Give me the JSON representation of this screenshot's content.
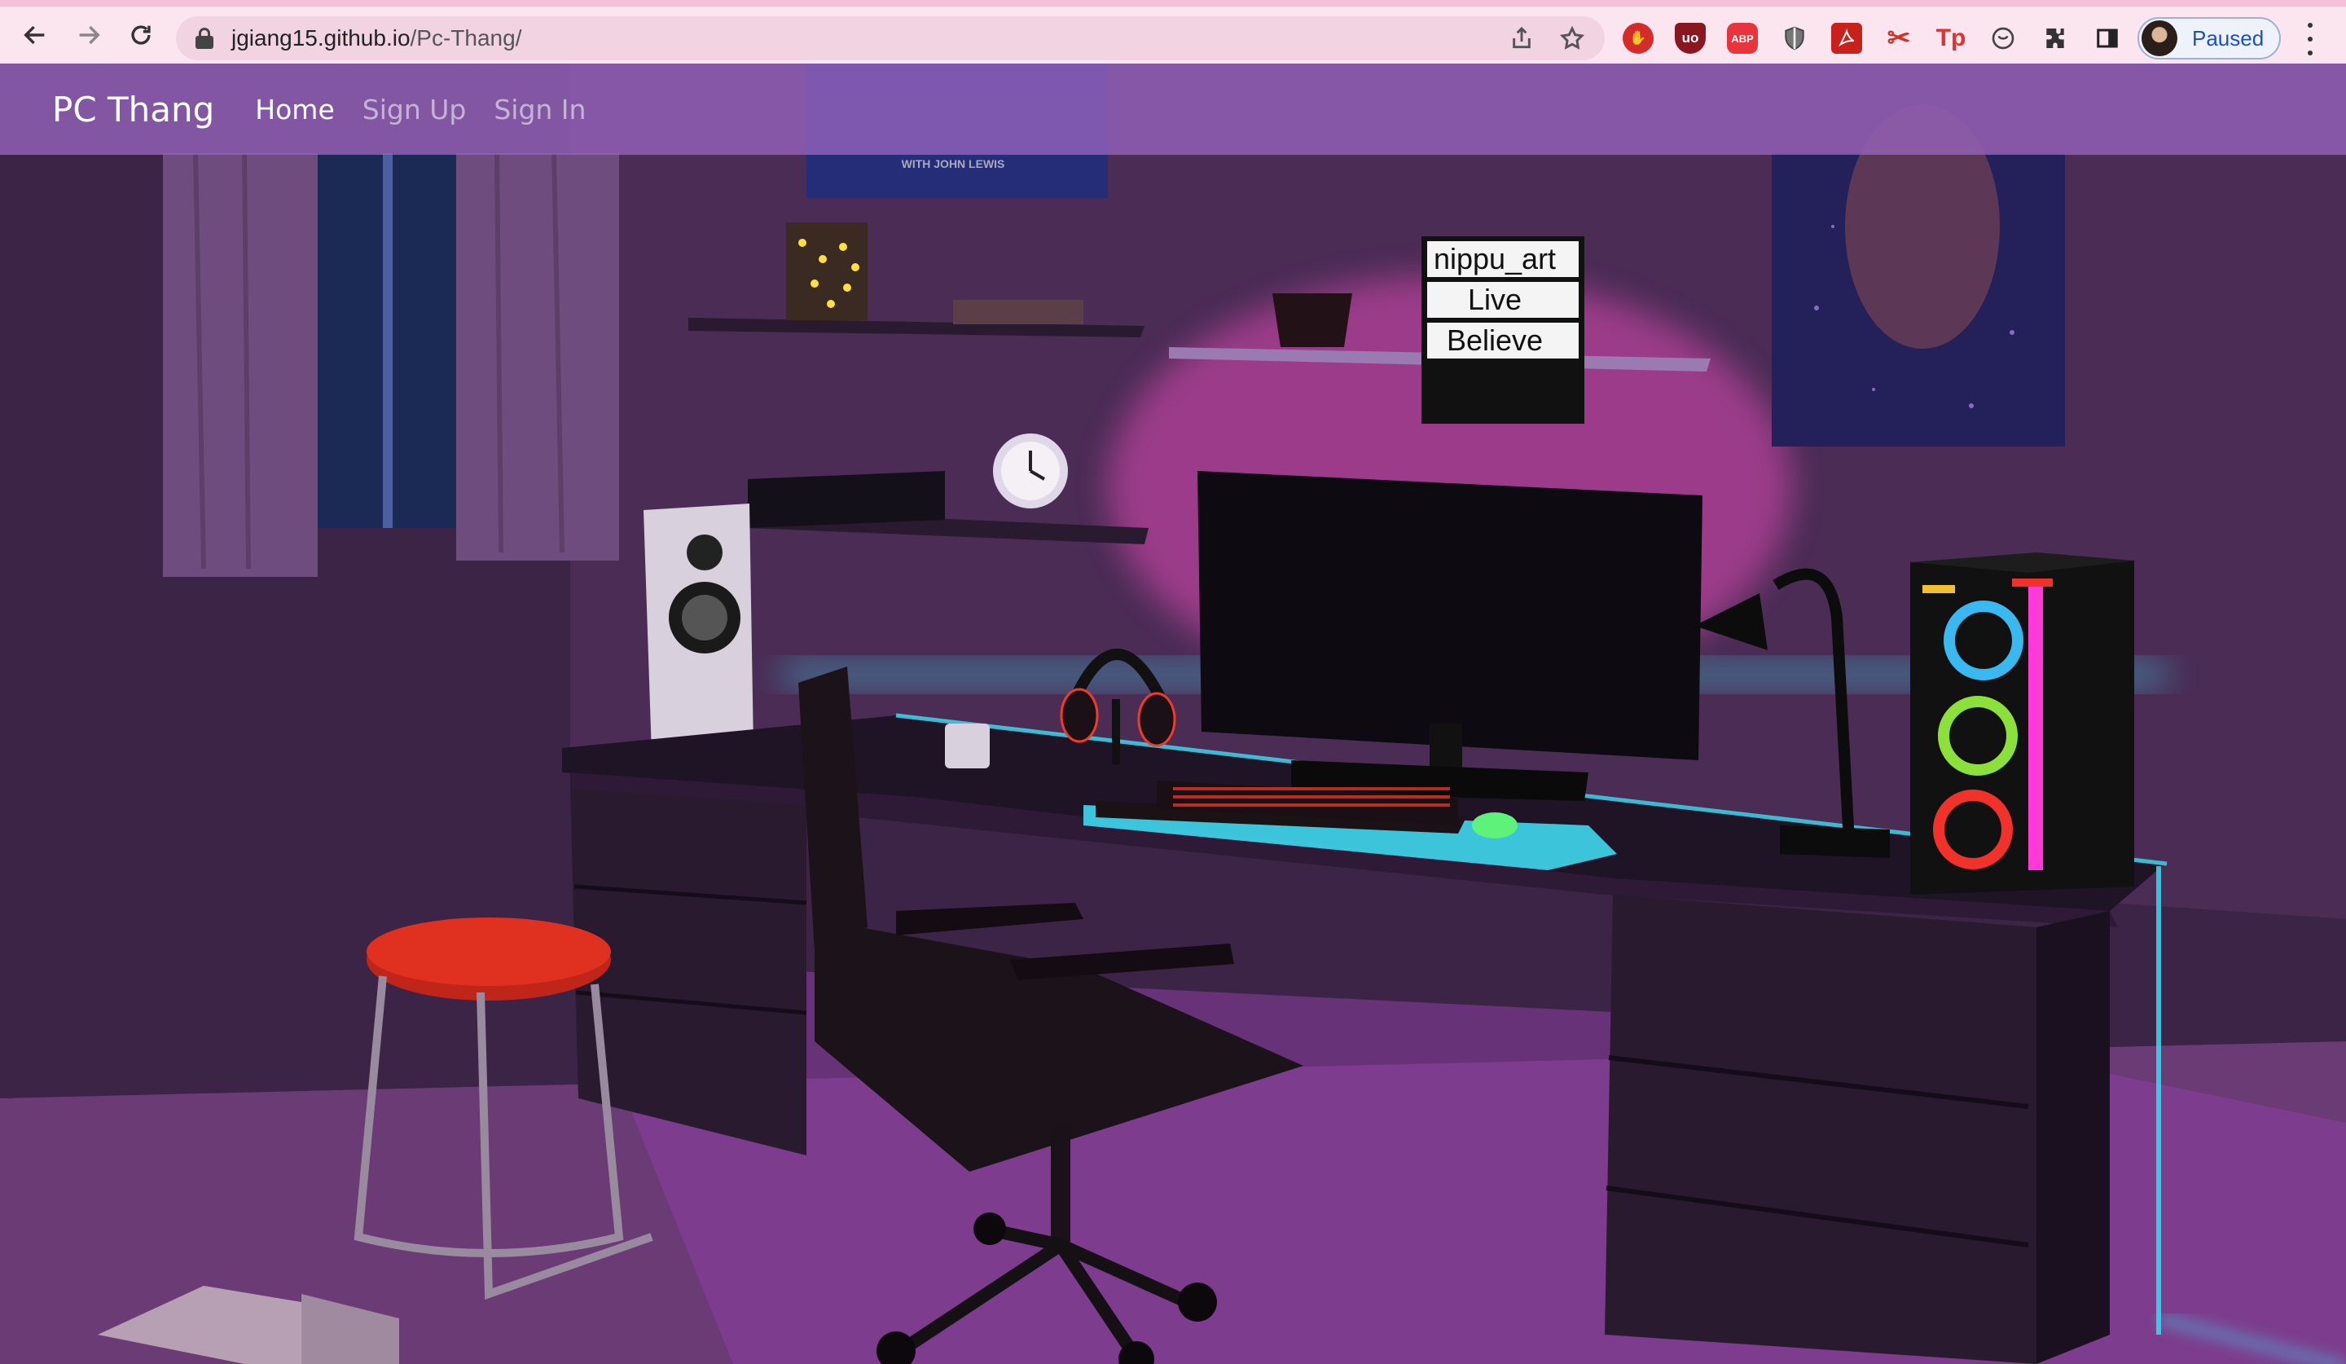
{
  "browser": {
    "url_host": "jgiang15.github.io",
    "url_path": "/Pc-Thang/",
    "profile_label": "Paused",
    "extensions": [
      {
        "name": "adblocker-extension-icon",
        "glyph": "✋",
        "color": "#d42b2b"
      },
      {
        "name": "ublock-extension-icon",
        "glyph": "uo",
        "color": "#8a1620"
      },
      {
        "name": "abp-extension-icon",
        "glyph": "ABP",
        "color": "#e8343c"
      },
      {
        "name": "shield-extension-icon",
        "glyph": "",
        "color": "#555555"
      },
      {
        "name": "pdf-extension-icon",
        "glyph": "",
        "color": "#c9201c"
      },
      {
        "name": "scissors-extension-icon",
        "glyph": "✂",
        "color": "#d4302a"
      },
      {
        "name": "tp-extension-icon",
        "glyph": "Tp",
        "color": "#e0322f"
      },
      {
        "name": "circle-extension-icon",
        "glyph": "",
        "color": "#444444"
      },
      {
        "name": "puzzle-extensions-icon",
        "glyph": "",
        "color": "#333333"
      },
      {
        "name": "sidepanel-icon",
        "glyph": "",
        "color": "#222222"
      }
    ]
  },
  "navbar": {
    "brand": "PC Thang",
    "links": [
      "Home",
      "Sign Up",
      "Sign In"
    ]
  },
  "scene": {
    "lightbox_lines": [
      "nippu_art",
      "Live",
      "Believe"
    ],
    "poster_caption": "WITH JOHN LEWIS",
    "colors": {
      "cyan_glow": "#3fd8f0",
      "pink_glow": "#ff4fc8",
      "ring_blue": "#3ab8f0",
      "ring_green": "#8be03a",
      "ring_red": "#f0322a"
    }
  }
}
